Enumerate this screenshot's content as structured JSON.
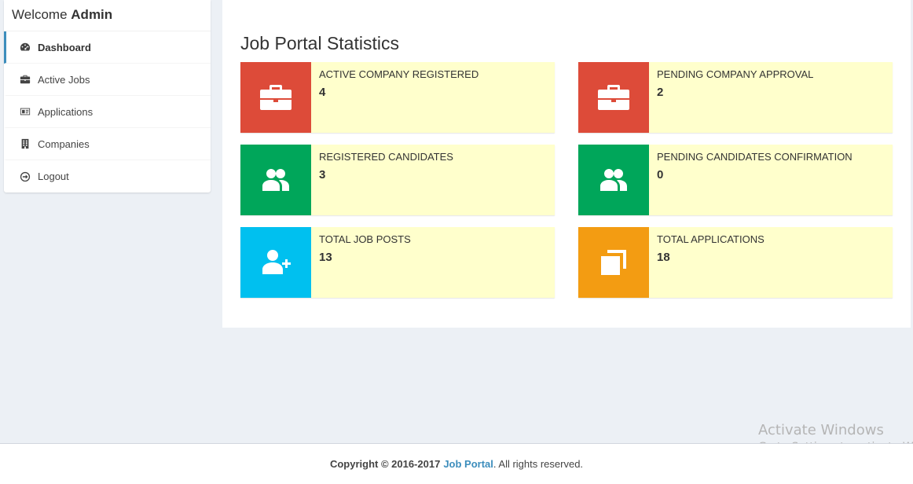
{
  "sidebar": {
    "welcome_text": "Welcome",
    "welcome_user": "Admin",
    "items": [
      {
        "label": "Dashboard",
        "icon": "dashboard-icon",
        "active": true
      },
      {
        "label": "Active Jobs",
        "icon": "briefcase-icon",
        "active": false
      },
      {
        "label": "Applications",
        "icon": "id-card-icon",
        "active": false
      },
      {
        "label": "Companies",
        "icon": "building-icon",
        "active": false
      },
      {
        "label": "Logout",
        "icon": "arrow-circle-icon",
        "active": false
      }
    ]
  },
  "main": {
    "title": "Job Portal Statistics",
    "boxes": [
      {
        "label": "ACTIVE COMPANY REGISTERED",
        "value": "4",
        "icon": "briefcase-icon",
        "color": "#dd4b39"
      },
      {
        "label": "PENDING COMPANY APPROVAL",
        "value": "2",
        "icon": "briefcase-icon",
        "color": "#dd4b39"
      },
      {
        "label": "REGISTERED CANDIDATES",
        "value": "3",
        "icon": "users-icon",
        "color": "#00a65a"
      },
      {
        "label": "PENDING CANDIDATES CONFIRMATION",
        "value": "0",
        "icon": "users-icon",
        "color": "#00a65a"
      },
      {
        "label": "TOTAL JOB POSTS",
        "value": "13",
        "icon": "user-plus-icon",
        "color": "#00c0ef"
      },
      {
        "label": "TOTAL APPLICATIONS",
        "value": "18",
        "icon": "files-icon",
        "color": "#f39c12"
      }
    ]
  },
  "footer": {
    "copyright": "Copyright © 2016-2017",
    "brand": "Job Portal",
    "suffix": ". All rights reserved."
  },
  "watermark": {
    "title": "Activate Windows",
    "subtitle": "Go to Settings to activate Windows."
  }
}
